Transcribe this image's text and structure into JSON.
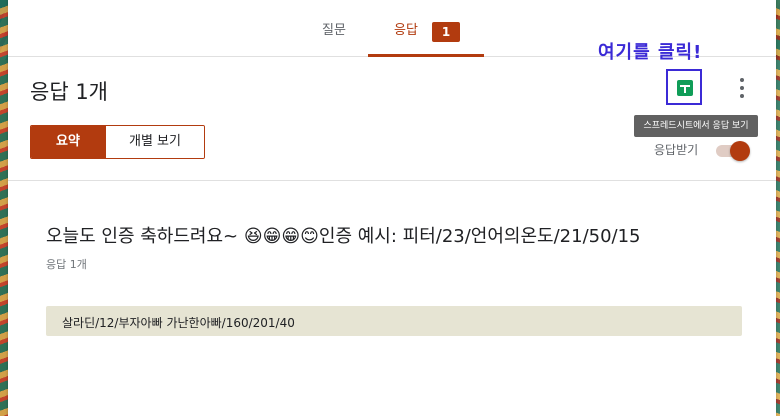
{
  "tabs": {
    "question_label": "질문",
    "response_label": "응답",
    "response_count": "1"
  },
  "annotation": "여기를 클릭!",
  "header": {
    "title": "응답 1개",
    "sheets_tooltip": "스프레드시트에서 응답 보기"
  },
  "view_toggle": {
    "summary_label": "요약",
    "individual_label": "개별 보기"
  },
  "accept_responses": {
    "label": "응답받기",
    "enabled": true
  },
  "question": {
    "title": "오늘도 인증 축하드려요~ 😆😁😁😊인증 예시: 피터/23/언어의온도/21/50/15",
    "response_count": "응답 1개",
    "answers": [
      "살라딘/12/부자아빠 가난한아빠/160/201/40"
    ]
  },
  "colors": {
    "accent": "#b23b0f",
    "sheets_green": "#0f9d58",
    "annotation_blue": "#3b2ad6",
    "answer_bg": "#e6e4d3"
  },
  "icons": [
    "sheets-icon",
    "more-vert-icon"
  ]
}
